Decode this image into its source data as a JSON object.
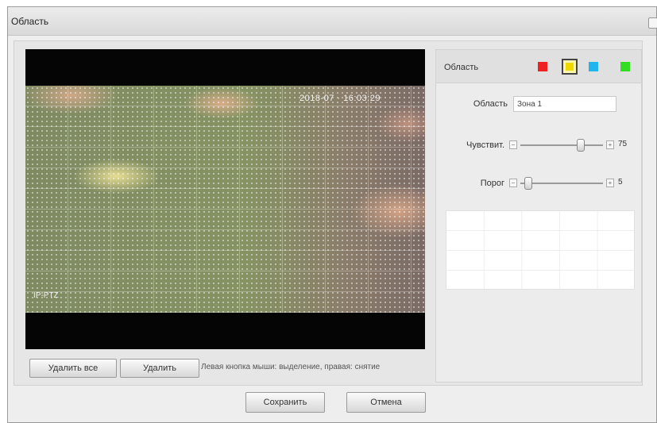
{
  "dialog": {
    "title": "Область"
  },
  "video": {
    "osd_time": "2018-07 · 16:03:29",
    "osd_camera": "IP-PTZ"
  },
  "video_buttons": {
    "delete_all": "Удалить все",
    "delete": "Удалить"
  },
  "hint": "Левая кнопка мыши: выделение, правая: снятие",
  "panel": {
    "title": "Область",
    "colors": [
      "#ee2222",
      "#f2d800",
      "#22b4ee",
      "#33dd22"
    ],
    "selected_color_index": 1,
    "name_label": "Область",
    "name_value": "Зона 1",
    "sensitivity_label": "Чувствит.",
    "sensitivity_value": "75",
    "sensitivity_fraction": 0.75,
    "threshold_label": "Порог",
    "threshold_value": "5",
    "threshold_fraction": 0.05,
    "minus_glyph": "−",
    "plus_glyph": "+"
  },
  "footer": {
    "save": "Сохранить",
    "cancel": "Отмена"
  }
}
